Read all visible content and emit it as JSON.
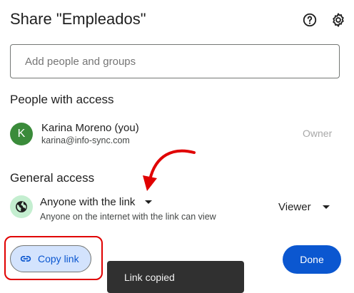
{
  "dialog": {
    "title": "Share \"Empleados\""
  },
  "add_people": {
    "placeholder": "Add people and groups"
  },
  "people_section": {
    "title": "People with access"
  },
  "people": [
    {
      "avatar_letter": "K",
      "name": "Karina Moreno (you)",
      "email": "karina@info-sync.com",
      "role": "Owner"
    }
  ],
  "general_access": {
    "title": "General access",
    "setting": "Anyone with the link",
    "description": "Anyone on the internet with the link can view",
    "role": "Viewer"
  },
  "actions": {
    "copy_link": "Copy link",
    "done": "Done"
  },
  "toast": {
    "message": "Link copied"
  },
  "icons": {
    "help": "help-circle-icon",
    "settings": "gear-icon",
    "globe": "globe-icon",
    "link": "link-icon"
  },
  "colors": {
    "primary": "#0b57d0",
    "copy_button_bg": "#d3e3fd",
    "avatar": "#3a8b3a",
    "globe_bg": "#c4eed0",
    "annotation": "#e00000",
    "toast_bg": "#303030"
  }
}
